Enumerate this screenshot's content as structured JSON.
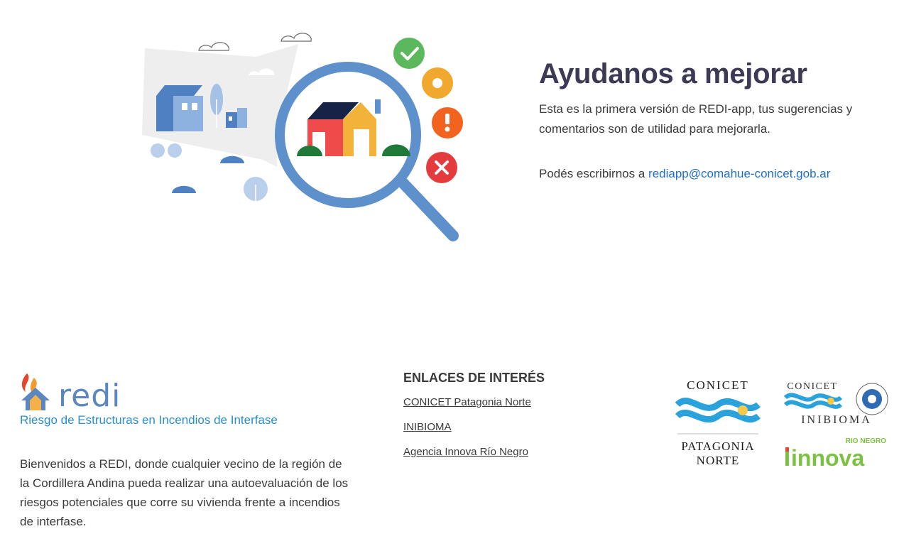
{
  "hero": {
    "title": "Ayudanos a mejorar",
    "description": "Esta es la primera versión de REDI-app, tus sugerencias y comentarios son de utilidad para mejorarla.",
    "contact_prefix": "Podés escribirnos a ",
    "contact_email": "rediapp@comahue-conicet.gob.ar"
  },
  "footer": {
    "brand": {
      "name": "redi",
      "tagline": "Riesgo de Estructuras en Incendios de Interfase",
      "description": "Bienvenidos a REDI, donde cualquier vecino de la región de la Cordillera Andina pueda realizar una autoevaluación de los riesgos potenciales que corre su vivienda frente a incendios de interfase."
    },
    "links": {
      "title": "ENLACES DE INTERÉS",
      "items": [
        "CONICET Patagonia Norte",
        "INIBIOMA",
        "Agencia Innova Río Negro"
      ]
    },
    "logos": {
      "conicet_top": "CONICET",
      "conicet_bottom_1": "PATAGONIA",
      "conicet_bottom_2": "NORTE",
      "inibioma_top": "CONICET",
      "inibioma_bottom": "INIBIOMA",
      "innova_small": "RIO NEGRO",
      "innova_main": "innova"
    }
  },
  "colors": {
    "title": "#3d3a55",
    "link": "#1f6fc9",
    "brand_blue": "#5b87c1",
    "tagline": "#2a8fc9"
  }
}
